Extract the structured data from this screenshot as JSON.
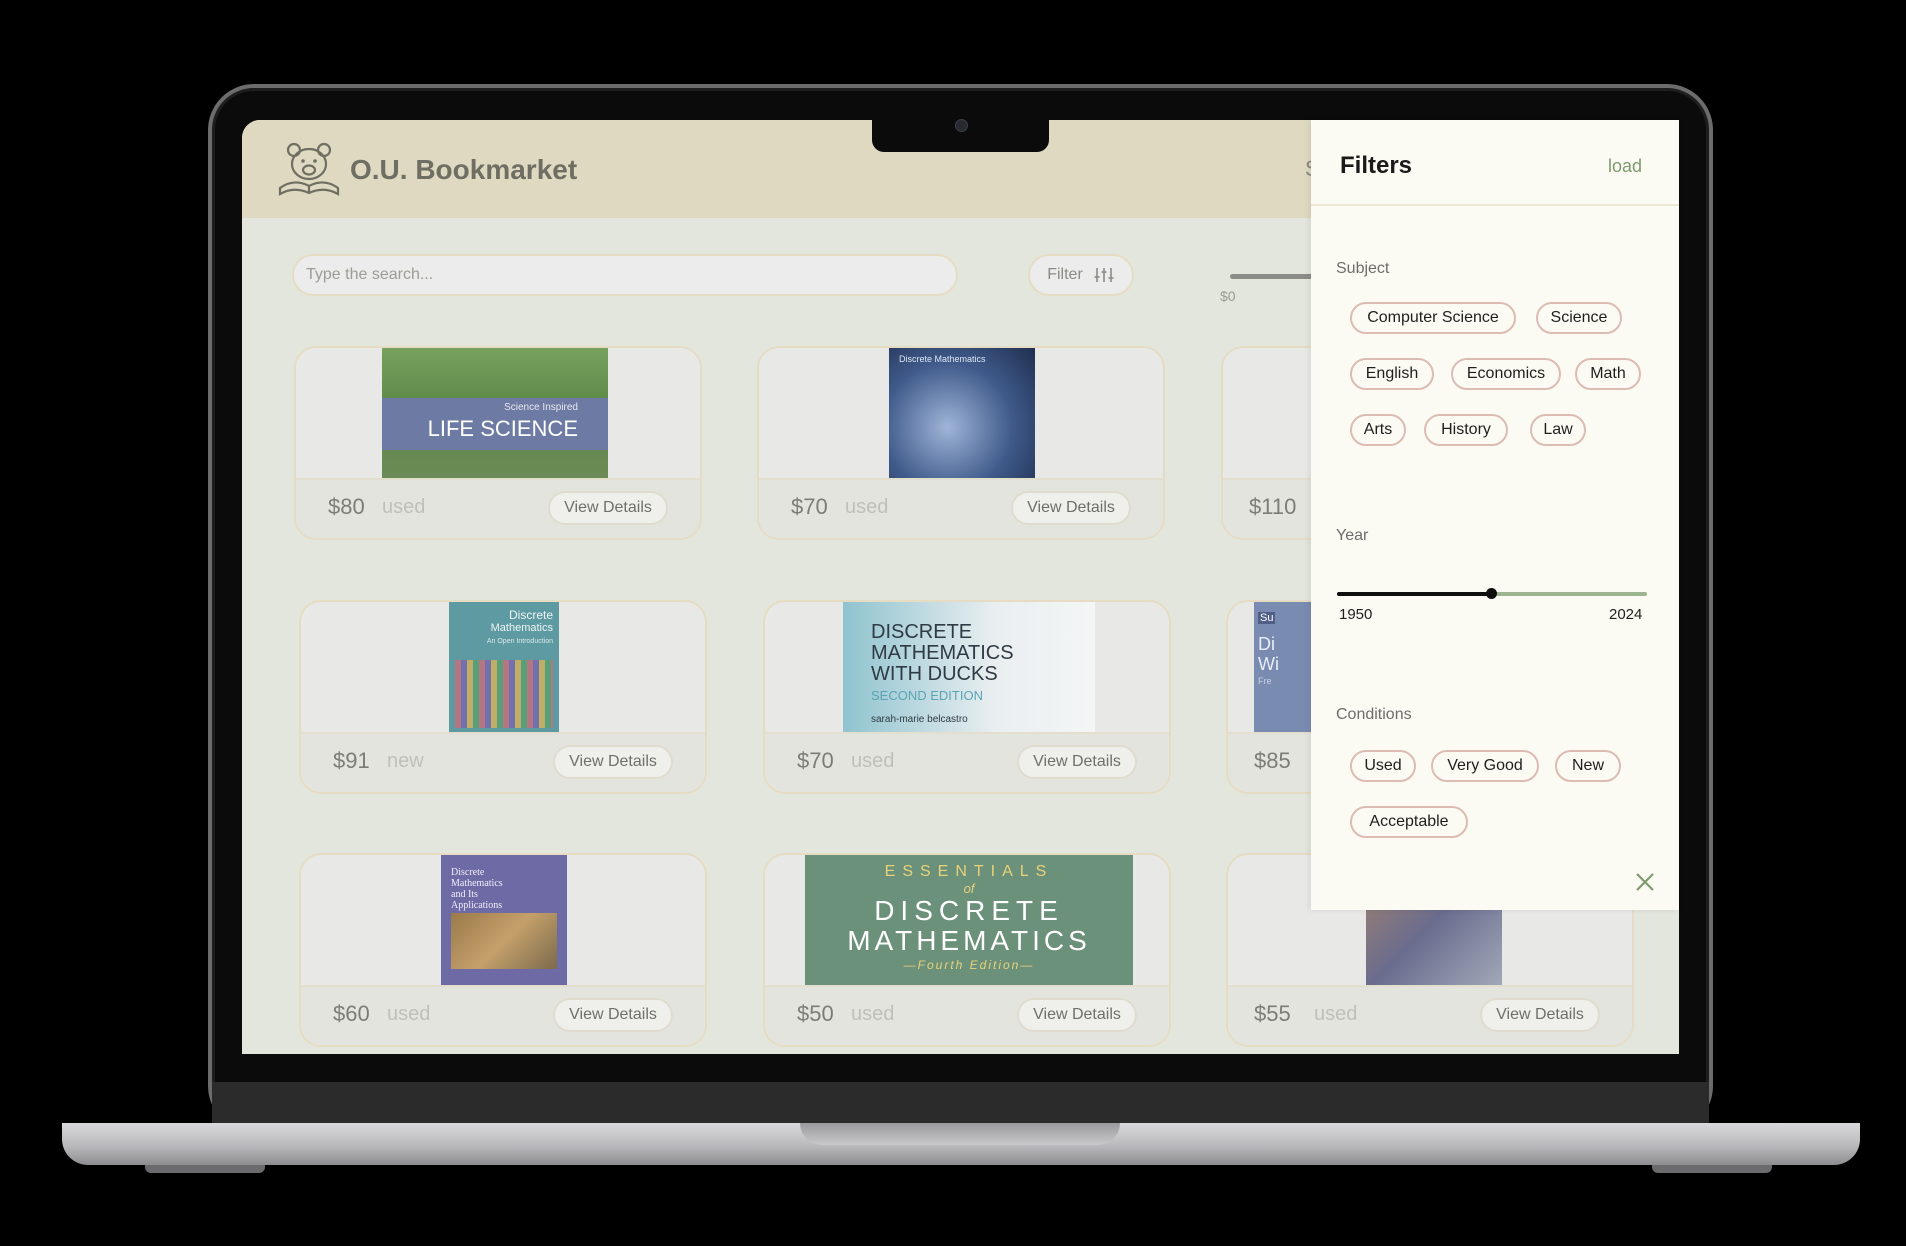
{
  "app": {
    "name": "O.U. Bookmarket",
    "header_hint": "S"
  },
  "search": {
    "placeholder": "Type the search..."
  },
  "filter_button": {
    "label": "Filter",
    "icon": "sliders-icon"
  },
  "price_slider": {
    "min_label": "$0"
  },
  "listings": [
    {
      "price": "$80",
      "condition": "used",
      "action": "View Details"
    },
    {
      "price": "$70",
      "condition": "used",
      "action": "View Details"
    },
    {
      "price": "$110",
      "condition": "",
      "action": ""
    },
    {
      "price": "$91",
      "condition": "new",
      "action": "View Details"
    },
    {
      "price": "$70",
      "condition": "used",
      "action": "View Details"
    },
    {
      "price": "$85",
      "condition": "",
      "action": ""
    },
    {
      "price": "$60",
      "condition": "used",
      "action": "View Details"
    },
    {
      "price": "$50",
      "condition": "used",
      "action": "View Details"
    },
    {
      "price": "$55",
      "condition": "used",
      "action": "View Details"
    }
  ],
  "covers": {
    "life_science": {
      "line1": "Science Inspired",
      "line2": "LIFE SCIENCE"
    },
    "discrete_blue": {
      "title": "Discrete Mathematics"
    },
    "discrete_grid": {
      "line1": "Discrete",
      "line2": "Mathematics",
      "subtitle": "An Open Introduction"
    },
    "ducks": {
      "l1": "DISCRETE",
      "l2": "MATHEMATICS",
      "l3": "WITH DUCKS",
      "l4": "SECOND EDITION",
      "author": "sarah-marie belcastro"
    },
    "ducks_partial": {
      "l1": "Su",
      "l2": "Di",
      "l3": "Wi",
      "l4": "Fre"
    },
    "apps": {
      "l1": "Discrete",
      "l2": "Mathematics",
      "l3": "and Its",
      "l4": "Applications"
    },
    "essentials": {
      "l1": "ESSENTIALS",
      "l2": "of",
      "l3": "DISCRETE",
      "l4": "MATHEMATICS",
      "l5": "—Fourth Edition—"
    }
  },
  "filters": {
    "title": "Filters",
    "load_label": "load",
    "subject_label": "Subject",
    "subjects": [
      "Computer Science",
      "Science",
      "English",
      "Economics",
      "Math",
      "Arts",
      "History",
      "Law"
    ],
    "year_label": "Year",
    "year_min": "1950",
    "year_max": "2024",
    "year_position": 0.5,
    "conditions_label": "Conditions",
    "conditions": [
      "Used",
      "Very Good",
      "New",
      "Acceptable"
    ]
  },
  "colors": {
    "header": "#dfd9c1",
    "panel": "#fbfbf3",
    "accent_green": "#7e9a6f",
    "chip_border": "#dcbcb2"
  }
}
